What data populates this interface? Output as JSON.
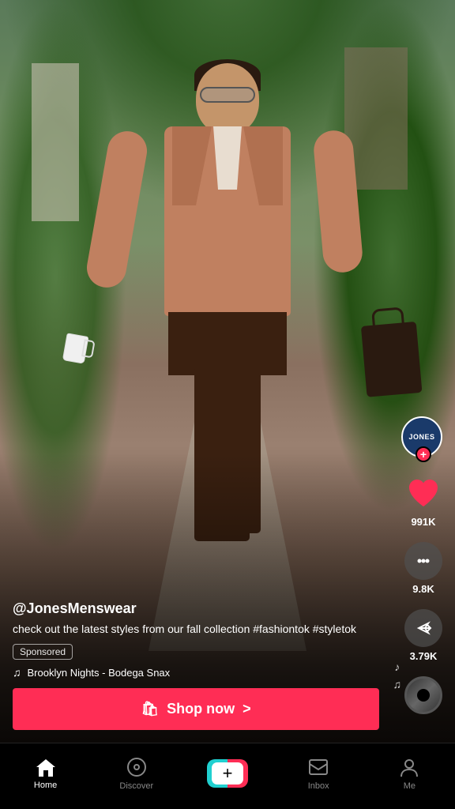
{
  "video": {
    "background_desc": "Man in brown blazer walking on a path surrounded by greenery"
  },
  "sidebar": {
    "avatar": {
      "brand_line1": "JONES",
      "brand_line2": "",
      "plus_icon": "+"
    },
    "like": {
      "icon": "♥",
      "count": "991K"
    },
    "comment": {
      "icon": "···",
      "count": "9.8K"
    },
    "share": {
      "count": "3.79K"
    }
  },
  "content": {
    "username": "@JonesMenswear",
    "description": "check out the latest styles from our fall collection #fashiontok #styletok",
    "sponsored_label": "Sponsored",
    "music_note": "♫",
    "music_text": "Brooklyn Nights - Bodega Snax",
    "shop_button": {
      "icon": "🛍",
      "label": "Shop now",
      "arrow": ">"
    }
  },
  "nav": {
    "items": [
      {
        "id": "home",
        "icon": "⌂",
        "label": "Home",
        "active": true
      },
      {
        "id": "discover",
        "icon": "○",
        "label": "Discover",
        "active": false
      },
      {
        "id": "create",
        "icon": "+",
        "label": "",
        "active": false
      },
      {
        "id": "inbox",
        "icon": "□",
        "label": "Inbox",
        "active": false
      },
      {
        "id": "me",
        "icon": "○",
        "label": "Me",
        "active": false
      }
    ]
  }
}
